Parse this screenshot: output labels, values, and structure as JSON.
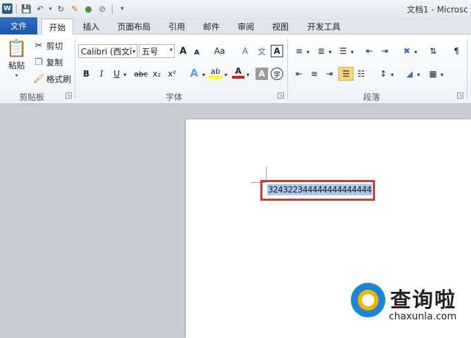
{
  "title_bar": {
    "app_icon": "W",
    "doc_title": "文档1 - Microsc",
    "qat_icons": [
      "save-icon",
      "undo-icon",
      "redo-icon",
      "format-painter-icon",
      "color-icon",
      "customize-icon"
    ]
  },
  "tabs": [
    {
      "label": "文件"
    },
    {
      "label": "开始"
    },
    {
      "label": "插入"
    },
    {
      "label": "页面布局"
    },
    {
      "label": "引用"
    },
    {
      "label": "邮件"
    },
    {
      "label": "审阅"
    },
    {
      "label": "视图"
    },
    {
      "label": "开发工具"
    }
  ],
  "clipboard": {
    "paste": "粘贴",
    "cut": "剪切",
    "copy": "复制",
    "format_painter": "格式刷",
    "group_label": "剪贴板"
  },
  "font": {
    "font_name": "Calibri (西文ī",
    "font_size": "五号",
    "bold": "B",
    "italic": "I",
    "underline": "U",
    "strike": "abc",
    "subscript": "x₂",
    "superscript": "x²",
    "text_effect": "A",
    "highlight": "ab",
    "font_color": "A",
    "char_shading": "A",
    "enclose": "字",
    "grow": "A",
    "shrink": "A",
    "change_case": "Aa",
    "clear": "A",
    "phonetic": "文",
    "border": "A",
    "group_label": "字体"
  },
  "paragraph": {
    "group_label": "段落"
  },
  "document": {
    "selected_text": "324322344444444444444"
  },
  "watermark": {
    "brand": "查询啦",
    "url": "chaxunla.com"
  },
  "colors": {
    "selection_highlight": "#a6c8ec",
    "annotation_box": "#d9333a",
    "file_tab": "#1b56a8"
  }
}
